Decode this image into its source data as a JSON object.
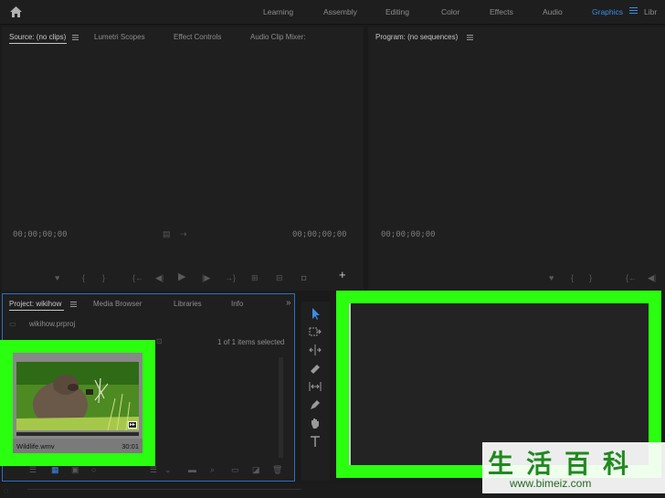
{
  "workspaces": [
    "Learning",
    "Assembly",
    "Editing",
    "Color",
    "Effects",
    "Audio",
    "Graphics",
    "Libr"
  ],
  "active_workspace": "Graphics",
  "source_panel": {
    "tabs": [
      "Source: (no clips)",
      "Lumetri Scopes",
      "Effect Controls",
      "Audio Clip Mixer:"
    ],
    "timecode_left": "00;00;00;00",
    "timecode_right": "00;00;00;00"
  },
  "program_panel": {
    "title": "Program: (no sequences)",
    "timecode_left": "00;00;00;00"
  },
  "project_panel": {
    "tabs": [
      "Project: wikihow",
      "Media Browser",
      "Libraries",
      "Info"
    ],
    "overflow": "»",
    "file_name": "wikihow.prproj",
    "items_selected": "1 of 1 items selected",
    "clip": {
      "name": "Wildlife.wmv",
      "duration": "30:01"
    }
  },
  "watermark": {
    "chars": "生活百科",
    "url": "www.bimeiz.com"
  },
  "colors": {
    "accent_blue": "#3a8ee6",
    "highlight_green": "#2aff0f",
    "panel_bg": "#1f1f1f"
  }
}
